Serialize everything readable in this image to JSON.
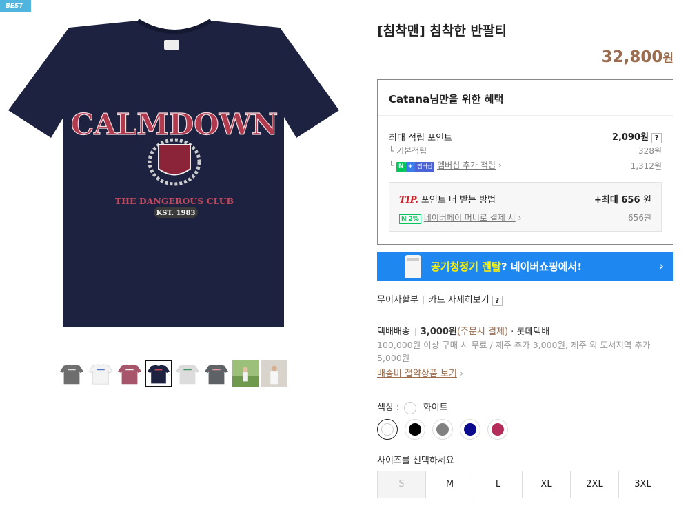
{
  "badge": "BEST",
  "product": {
    "title": "[침착맨] 침착한 반팔티",
    "price": "32,800",
    "price_unit": "원"
  },
  "shirt_print": {
    "brand": "CALMDOWN",
    "club": "THE DANGEROUS CLUB",
    "est": "KST. 1983"
  },
  "benefit": {
    "heading_user": "Catana",
    "heading_rest": "님만을 위한 혜택",
    "max_points_label": "최대 적립 포인트",
    "max_points_value": "2,090원",
    "qmark": "?",
    "basic_label": "기본적립",
    "basic_value": "328원",
    "membership_badge_n": "N",
    "membership_badge_plus": "+",
    "membership_badge_text": "멤버십",
    "membership_label": "멤버십 추가 적립",
    "membership_value": "1,312원",
    "tip_label": "TIP.",
    "tip_text": "포인트 더 받는 방법",
    "tip_value": "+최대 656",
    "tip_unit": "원",
    "pay_badge": "N 2%",
    "pay_label": "네이버페이 머니로 결제 시",
    "pay_value": "656원"
  },
  "banner": {
    "part1": "공기청정기 렌탈",
    "part2": "? 네이버쇼핑에서!",
    "arrow": "›"
  },
  "card": {
    "installment": "무이자할부",
    "detail": "카드 자세히보기",
    "qmark": "?"
  },
  "shipping": {
    "method": "택배배송",
    "fee": "3,000원",
    "pay_when": "(주문시 결제)",
    "courier": "· 롯데택배",
    "desc": "100,000원 이상 구매 시 무료 / 제주 추가 3,000원, 제주 외 도서지역 추가 5,000원",
    "saving_link": "배송비 절약상품 보기"
  },
  "color": {
    "label": "색상 :",
    "selected": "화이트",
    "swatches": [
      "#ffffff",
      "#000000",
      "#808080",
      "#0a0a8c",
      "#b42d5a"
    ]
  },
  "size": {
    "label": "사이즈를 선택하세요",
    "options": [
      "S",
      "M",
      "L",
      "XL",
      "2XL",
      "3XL"
    ]
  },
  "colors": {
    "navy": "#1c2240",
    "accent_price": "#9b6c4d",
    "banner_blue": "#1e88f0"
  }
}
